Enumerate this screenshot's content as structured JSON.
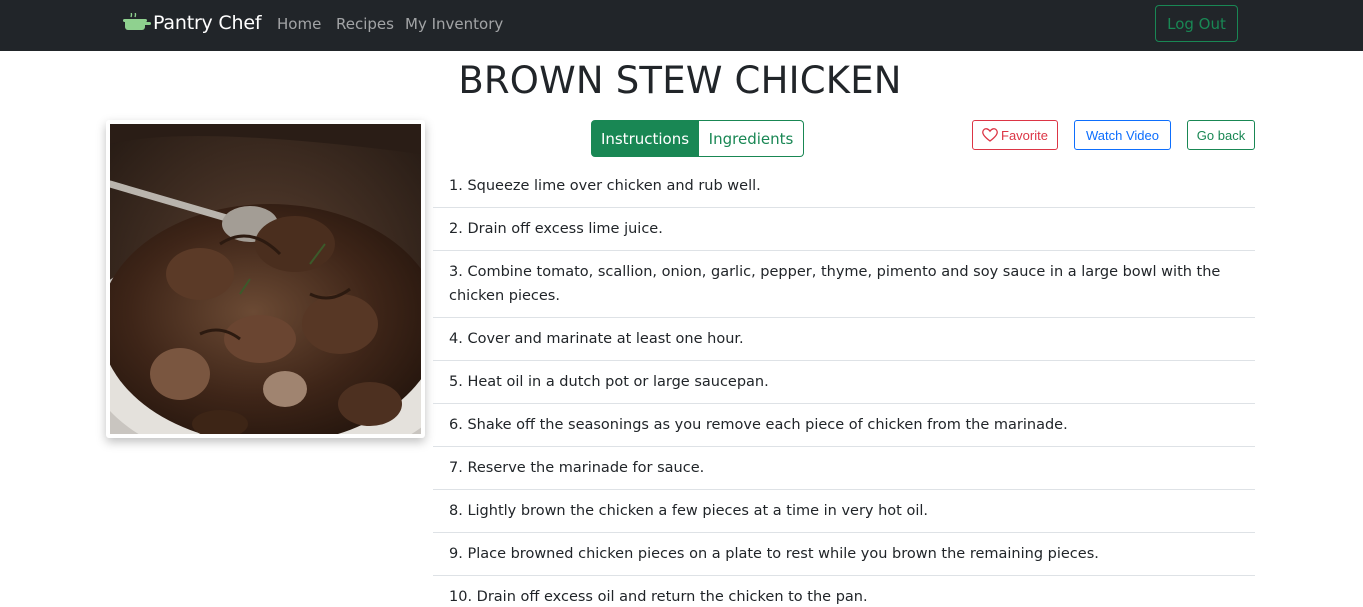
{
  "nav": {
    "brand": "Pantry Chef",
    "links": [
      "Home",
      "Recipes",
      "My Inventory"
    ],
    "logout_label": "Log Out",
    "logo_icon": "pot-icon",
    "logo_color": "#8fd18f"
  },
  "recipe": {
    "title": "BROWN STEW CHICKEN",
    "image_subject": "brown stew chicken in a white bowl"
  },
  "tabs": {
    "active": "Instructions",
    "inactive": "Ingredients"
  },
  "actions": {
    "favorite_label": "Favorite",
    "favorite_icon": "heart-icon",
    "watch_label": "Watch Video",
    "back_label": "Go back"
  },
  "steps": [
    "1. Squeeze lime over chicken and rub well.",
    "2. Drain off excess lime juice.",
    "3. Combine tomato, scallion, onion, garlic, pepper, thyme, pimento and soy sauce in a large bowl with the chicken pieces.",
    "4. Cover and marinate at least one hour.",
    "5. Heat oil in a dutch pot or large saucepan.",
    "6. Shake off the seasonings as you remove each piece of chicken from the marinade.",
    "7. Reserve the marinade for sauce.",
    "8. Lightly brown the chicken a few pieces at a time in very hot oil.",
    "9. Place browned chicken pieces on a plate to rest while you brown the remaining pieces.",
    "10. Drain off excess oil and return the chicken to the pan."
  ],
  "colors": {
    "navbar": "#212529",
    "primary_green": "#198754",
    "danger": "#dc3545",
    "blue": "#0d6efd"
  }
}
